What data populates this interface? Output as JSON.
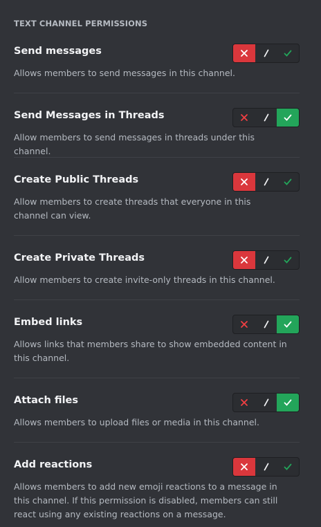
{
  "section_title": "TEXT CHANNEL PERMISSIONS",
  "colors": {
    "background": "#313338",
    "deny_active": "#da373c",
    "allow_active": "#23a55a",
    "deny_icon_inactive": "#f23f43",
    "allow_icon_inactive": "#23a55a"
  },
  "permissions": [
    {
      "name": "Send messages",
      "description": "Allows members to send messages in this channel.",
      "state": "deny"
    },
    {
      "name": "Send Messages in Threads",
      "description": "Allow members to send messages in threads under this channel.",
      "state": "allow"
    },
    {
      "name": "Create Public Threads",
      "description": "Allow members to create threads that everyone in this channel can view.",
      "state": "deny"
    },
    {
      "name": "Create Private Threads",
      "description": "Allow members to create invite-only threads in this channel.",
      "state": "deny"
    },
    {
      "name": "Embed links",
      "description": "Allows links that members share to show embedded content in this channel.",
      "state": "allow"
    },
    {
      "name": "Attach files",
      "description": "Allows members to upload files or media in this channel.",
      "state": "allow"
    },
    {
      "name": "Add reactions",
      "description": "Allows members to add new emoji reactions to a message in this channel. If this permission is disabled, members can still react using any existing reactions on a message.",
      "state": "deny"
    }
  ],
  "icons": {
    "deny": "x-icon",
    "neutral": "slash-icon",
    "allow": "check-icon"
  }
}
